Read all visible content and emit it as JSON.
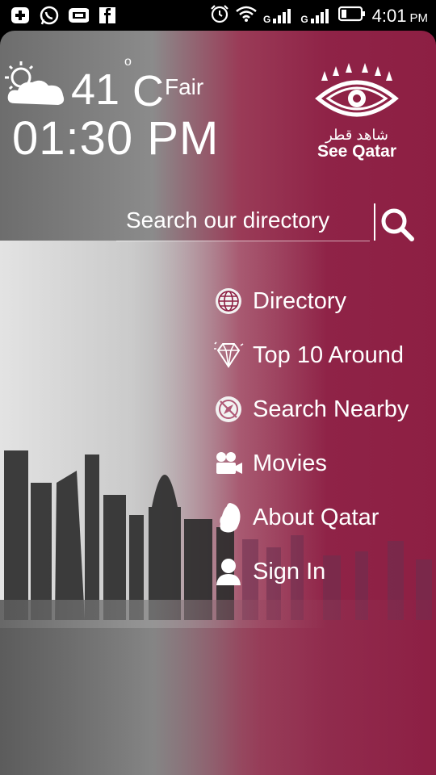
{
  "status_bar": {
    "time": "4:01",
    "ampm": "PM",
    "signal_1": "G",
    "signal_2": "G",
    "left_icons": [
      "add-icon",
      "whatsapp-icon",
      "mobile-icon",
      "facebook-icon"
    ],
    "right_icons": [
      "alarm-icon",
      "wifi-icon",
      "signal-icon",
      "signal-icon",
      "battery-icon"
    ]
  },
  "weather": {
    "icon": "partly-cloudy-icon",
    "temp": "41",
    "degree": "o",
    "unit": "C",
    "condition": "Fair",
    "time": "01:30 PM"
  },
  "logo": {
    "arabic": "شاهد قطر",
    "latin": "See Qatar"
  },
  "search": {
    "placeholder": "Search our directory"
  },
  "menu": [
    {
      "label": "Directory",
      "icon": "globe-icon"
    },
    {
      "label": "Top 10 Around",
      "icon": "diamond-icon"
    },
    {
      "label": "Search Nearby",
      "icon": "compass-icon"
    },
    {
      "label": "Movies",
      "icon": "camera-icon"
    },
    {
      "label": "About Qatar",
      "icon": "qatar-map-icon"
    },
    {
      "label": "Sign In",
      "icon": "user-icon"
    }
  ],
  "colors": {
    "brand": "#8d1f43",
    "gray": "#8b8b8b"
  }
}
